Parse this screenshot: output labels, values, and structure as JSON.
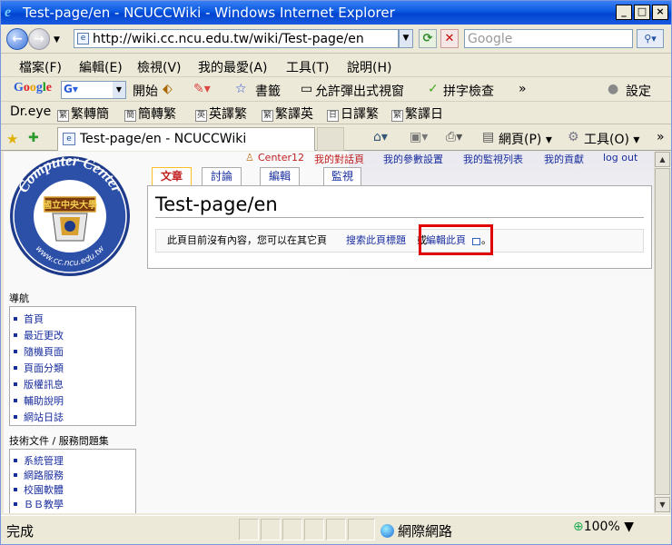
{
  "window": {
    "title": "Test-page/en - NCUCCWiki - Windows Internet Explorer",
    "min_label": "_",
    "max_label": "□",
    "close_label": "×"
  },
  "address": {
    "url": "http://wiki.cc.ncu.edu.tw/wiki/Test-page/en",
    "search_placeholder": "Google"
  },
  "menu": [
    "檔案(F)",
    "編輯(E)",
    "檢視(V)",
    "我的最愛(A)",
    "工具(T)",
    "說明(H)"
  ],
  "google_toolbar": {
    "logo": "Google",
    "start": "開始",
    "bookmarks": "書籤",
    "popup": "允許彈出式視窗",
    "spell": "拼字檢查",
    "more": "»",
    "settings": "設定"
  },
  "dreye_toolbar": {
    "name": "Dr.eye",
    "items": [
      "繁轉簡",
      "簡轉繁",
      "英譯繁",
      "繁譯英",
      "日譯繁",
      "繁譯日"
    ],
    "item_icons": [
      "繁",
      "簡",
      "英",
      "繁",
      "日",
      "繁"
    ]
  },
  "tab": {
    "title": "Test-page/en - NCUCCWiki"
  },
  "commands": {
    "page": "網頁(P)",
    "tools": "工具(O)",
    "more": "»"
  },
  "wiki": {
    "personal": {
      "user": "Center12",
      "talk": "我的對話頁",
      "prefs": "我的參數設置",
      "watchlist": "我的監視列表",
      "contribs": "我的貢獻",
      "logout": "log out"
    },
    "tabs": [
      "文章",
      "討論",
      "編輯",
      "監視"
    ],
    "logo": {
      "ring_text": "Computer Center",
      "badge": "國立中央大學",
      "url": "www.cc.ncu.edu.tw"
    },
    "page_title": "Test-page/en",
    "notice": {
      "prefix": "此頁目前沒有內容，您可以在其它頁",
      "search_link": "搜索此頁標題",
      "or": "或",
      "edit_link": "編輯此頁",
      "suffix": "。"
    },
    "nav_heading": "導航",
    "nav_items": [
      "首頁",
      "最近更改",
      "隨機頁面",
      "頁面分類",
      "版權訊息",
      "輔助說明",
      "網站日誌"
    ],
    "tech_heading": "技術文件 / 服務問題集",
    "tech_items": [
      "系統管理",
      "網路服務",
      "校園軟體",
      "ＢＢ教學"
    ]
  },
  "status": {
    "text": "完成",
    "zone": "網際網路",
    "zoom": "100%"
  },
  "colors": {
    "title_bar": "#0a58e0",
    "link": "#1a2e9e",
    "highlight_box": "#e00000",
    "selected_tab_text": "#c02020"
  }
}
